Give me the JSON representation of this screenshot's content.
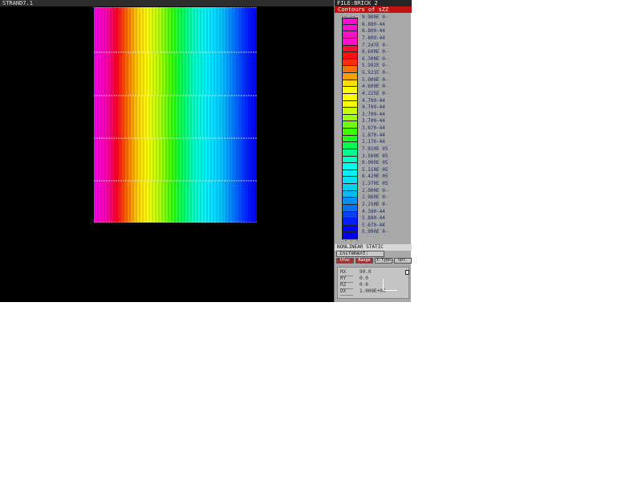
{
  "viewport": {
    "title": "STRAND7.1"
  },
  "panel": {
    "title": "FILE:BRICK 2",
    "legend_title": "Contours of sZZ",
    "legend_head": "-- --",
    "legend_foot": "- - -",
    "legend_items": [
      {
        "color": "#ff10c8",
        "label": "9.900E 0-"
      },
      {
        "color": "#ff10c8",
        "label": "8.880-44"
      },
      {
        "color": "#ff10c8",
        "label": "8.800-44"
      },
      {
        "color": "#ff10c8",
        "label": "7.800-44"
      },
      {
        "color": "#ff1030",
        "label": "7.247E 0-"
      },
      {
        "color": "#ff1010",
        "label": "6.600E 0-"
      },
      {
        "color": "#ff3000",
        "label": "6.300E 0-"
      },
      {
        "color": "#ff7000",
        "label": "5.992E 0-"
      },
      {
        "color": "#ffa000",
        "label": "5.521E 0-"
      },
      {
        "color": "#ffe000",
        "label": "5.000E 0-"
      },
      {
        "color": "#ffff00",
        "label": "4.600E 0-"
      },
      {
        "color": "#ffff00",
        "label": "4.225E 0-"
      },
      {
        "color": "#ffff00",
        "label": "4.700-44"
      },
      {
        "color": "#c8ff00",
        "label": "4.700-44"
      },
      {
        "color": "#a0ff00",
        "label": "3.700-44"
      },
      {
        "color": "#70ff00",
        "label": "3.700-44"
      },
      {
        "color": "#40ff00",
        "label": "3.070-44"
      },
      {
        "color": "#20ff20",
        "label": "1.870-44"
      },
      {
        "color": "#00ff50",
        "label": "1.170-44"
      },
      {
        "color": "#00ff90",
        "label": "7.010E 05"
      },
      {
        "color": "#00ffc0",
        "label": "3.500E 05"
      },
      {
        "color": "#00ffe8",
        "label": "0.000E 05"
      },
      {
        "color": "#00f0ff",
        "label": "5.110E 05"
      },
      {
        "color": "#00e0ff",
        "label": "6.420E 05"
      },
      {
        "color": "#00d0ff",
        "label": "1.370E 05"
      },
      {
        "color": "#00b8ff",
        "label": "1.000E 0-"
      },
      {
        "color": "#0090ff",
        "label": "1.960E 0-"
      },
      {
        "color": "#0070ff",
        "label": "2.250E 0-"
      },
      {
        "color": "#0040ff",
        "label": "4.380-44"
      },
      {
        "color": "#0020ff",
        "label": "5.880-44"
      },
      {
        "color": "#0000ff",
        "label": "5.670-44"
      },
      {
        "color": "#0000e0",
        "label": "5.990E 0-"
      }
    ],
    "analysis_type": "NONLINEAR STATIC",
    "increment_label": "Increment:",
    "buttons": [
      "Ufac",
      "Range",
      "X.Type",
      "Opt."
    ],
    "coords": [
      {
        "key": "RX",
        "value": "90.0"
      },
      {
        "key": "RY",
        "value": "0.0"
      },
      {
        "key": "RZ",
        "value": "0.0"
      },
      {
        "key": "DX",
        "value": "1.000E+00"
      }
    ]
  }
}
